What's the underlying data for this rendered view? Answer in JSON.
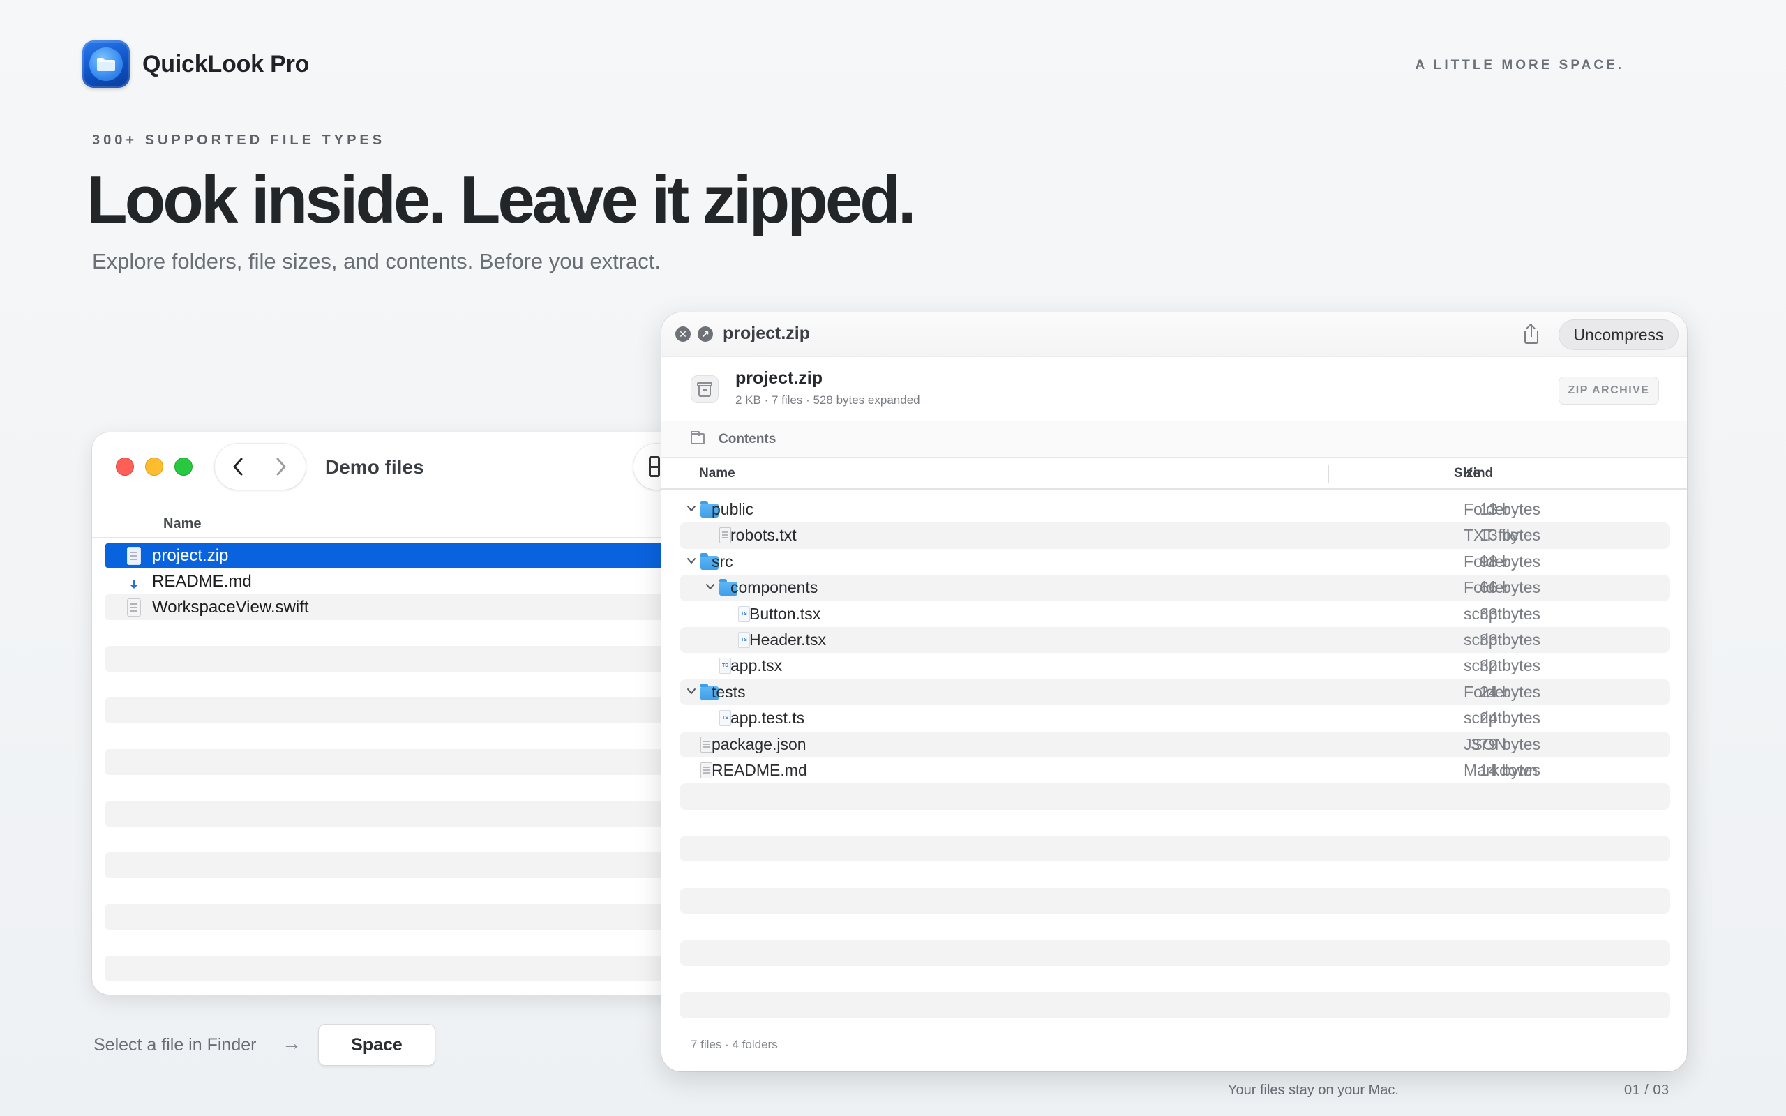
{
  "brand": {
    "name": "QuickLook Pro",
    "icon": "folder-app-icon",
    "accent": "#0a63de"
  },
  "tagline": "A LITTLE MORE SPACE.",
  "hero": {
    "eyebrow": "300+ SUPPORTED FILE TYPES",
    "headline": "Look inside. Leave it zipped.",
    "subhead": "Explore folders, file sizes, and contents. Before you extract."
  },
  "finder": {
    "title": "Demo files",
    "column_name": "Name",
    "files": [
      {
        "name": "project.zip",
        "icon": "zip-file-icon",
        "selected": true
      },
      {
        "name": "README.md",
        "icon": "download-icon",
        "selected": false
      },
      {
        "name": "WorkspaceView.swift",
        "icon": "swift-file-icon",
        "selected": false
      }
    ]
  },
  "quicklook": {
    "title": "project.zip",
    "uncompress_label": "Uncompress",
    "archive": {
      "name": "project.zip",
      "meta": "2 KB  ·  7 files · 528 bytes expanded",
      "badge": "ZIP ARCHIVE"
    },
    "contents_label": "Contents",
    "columns": {
      "name": "Name",
      "size": "Size",
      "kind": "Kind"
    },
    "rows": [
      {
        "depth": 0,
        "expanded": true,
        "type": "folder",
        "name": "public",
        "size": "13 bytes",
        "kind": "Folder"
      },
      {
        "depth": 1,
        "type": "txt",
        "name": "robots.txt",
        "size": "13 bytes",
        "kind": "TXT file"
      },
      {
        "depth": 0,
        "expanded": true,
        "type": "folder",
        "name": "src",
        "size": "98 bytes",
        "kind": "Folder"
      },
      {
        "depth": 1,
        "expanded": true,
        "type": "folder",
        "name": "components",
        "size": "66 bytes",
        "kind": "Folder"
      },
      {
        "depth": 2,
        "type": "ts",
        "name": "Button.tsx",
        "size": "33 bytes",
        "kind": "script"
      },
      {
        "depth": 2,
        "type": "ts",
        "name": "Header.tsx",
        "size": "33 bytes",
        "kind": "script"
      },
      {
        "depth": 1,
        "type": "ts",
        "name": "app.tsx",
        "size": "32 bytes",
        "kind": "script"
      },
      {
        "depth": 0,
        "expanded": true,
        "type": "folder",
        "name": "tests",
        "size": "24 bytes",
        "kind": "Folder"
      },
      {
        "depth": 1,
        "type": "ts",
        "name": "app.test.ts",
        "size": "24 bytes",
        "kind": "script"
      },
      {
        "depth": 0,
        "type": "txt",
        "name": "package.json",
        "size": "379 bytes",
        "kind": "JSON"
      },
      {
        "depth": 0,
        "type": "txt",
        "name": "README.md",
        "size": "14 bytes",
        "kind": "Markdown"
      }
    ],
    "footer": "7 files · 4 folders"
  },
  "bottom": {
    "hint": "Select a file in Finder",
    "key_label": "Space",
    "privacy": "Your files stay on your Mac.",
    "pager": "01 / 03"
  }
}
